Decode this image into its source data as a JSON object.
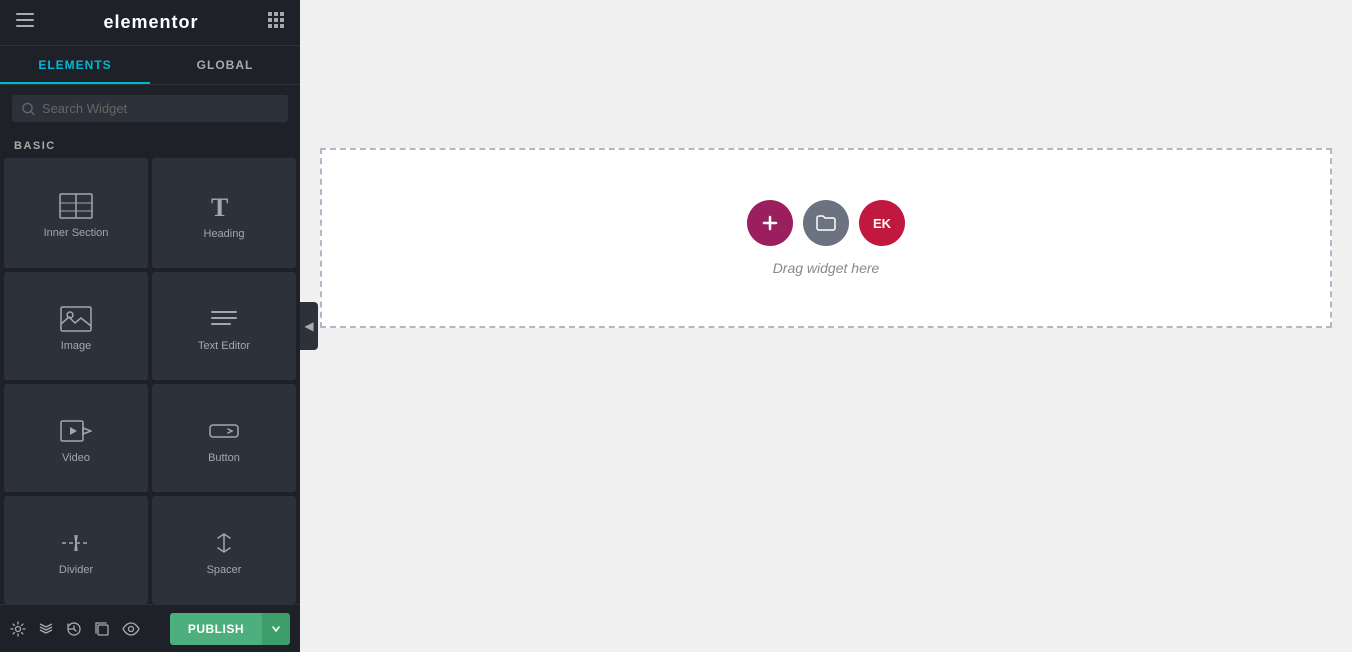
{
  "header": {
    "logo": "elementor",
    "hamburger_label": "☰",
    "apps_label": "⠿"
  },
  "tabs": [
    {
      "id": "elements",
      "label": "ELEMENTS",
      "active": true
    },
    {
      "id": "global",
      "label": "GLOBAL",
      "active": false
    }
  ],
  "search": {
    "placeholder": "Search Widget"
  },
  "sections": [
    {
      "id": "basic",
      "label": "BASIC",
      "widgets": [
        {
          "id": "inner-section",
          "label": "Inner Section",
          "icon": "inner-section-icon"
        },
        {
          "id": "heading",
          "label": "Heading",
          "icon": "heading-icon"
        },
        {
          "id": "image",
          "label": "Image",
          "icon": "image-icon"
        },
        {
          "id": "text-editor",
          "label": "Text Editor",
          "icon": "text-editor-icon"
        },
        {
          "id": "video",
          "label": "Video",
          "icon": "video-icon"
        },
        {
          "id": "button",
          "label": "Button",
          "icon": "button-icon"
        },
        {
          "id": "divider",
          "label": "Divider",
          "icon": "divider-icon"
        },
        {
          "id": "spacer",
          "label": "Spacer",
          "icon": "spacer-icon"
        }
      ]
    }
  ],
  "canvas": {
    "drop_text": "Drag widget here",
    "add_btn_label": "+",
    "folder_btn_label": "🗂",
    "ek_btn_label": "EK"
  },
  "bottom_bar": {
    "publish_label": "PUBLISH",
    "arrow_label": "▾",
    "icons": [
      "gear-icon",
      "layers-icon",
      "history-icon",
      "duplicate-icon",
      "eye-icon"
    ]
  }
}
